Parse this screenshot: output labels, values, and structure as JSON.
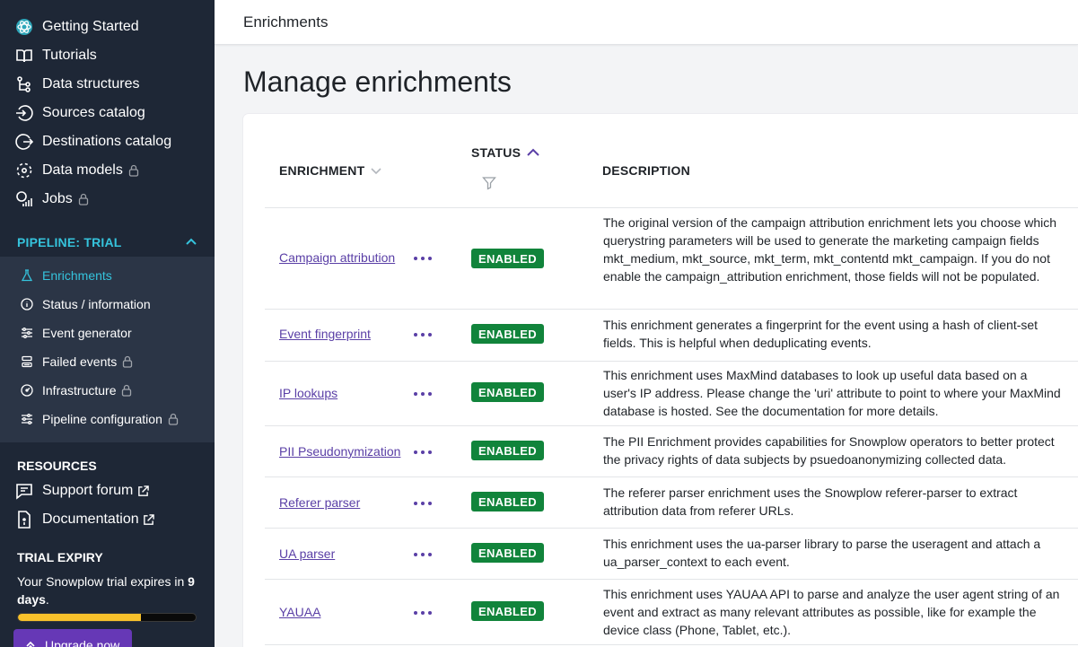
{
  "sidebar": {
    "nav": [
      {
        "label": "Getting Started",
        "icon": "atom-icon",
        "locked": false
      },
      {
        "label": "Tutorials",
        "icon": "book-icon",
        "locked": false
      },
      {
        "label": "Data structures",
        "icon": "hierarchy-icon",
        "locked": false
      },
      {
        "label": "Sources catalog",
        "icon": "source-enter-icon",
        "locked": false
      },
      {
        "label": "Destinations catalog",
        "icon": "destination-arrow-icon",
        "locked": false
      },
      {
        "label": "Data models",
        "icon": "model-dots-icon",
        "locked": true
      },
      {
        "label": "Jobs",
        "icon": "jobs-bars-icon",
        "locked": true
      }
    ],
    "pipeline": {
      "heading": "PIPELINE: TRIAL",
      "items": [
        {
          "label": "Enrichments",
          "icon": "flask-icon",
          "locked": false,
          "active": true
        },
        {
          "label": "Status / information",
          "icon": "info-circle-icon",
          "locked": false,
          "active": false
        },
        {
          "label": "Event generator",
          "icon": "sliders-icon",
          "locked": false,
          "active": false
        },
        {
          "label": "Failed events",
          "icon": "failed-layers-icon",
          "locked": true,
          "active": false
        },
        {
          "label": "Infrastructure",
          "icon": "gauge-icon",
          "locked": true,
          "active": false
        },
        {
          "label": "Pipeline configuration",
          "icon": "config-sliders-icon",
          "locked": true,
          "active": false
        }
      ]
    },
    "resources": {
      "heading": "RESOURCES",
      "items": [
        {
          "label": "Support forum",
          "icon": "chat-icon"
        },
        {
          "label": "Documentation",
          "icon": "document-icon"
        }
      ]
    },
    "trial": {
      "heading": "TRIAL EXPIRY",
      "text_prefix": "Your Snowplow trial expires in ",
      "days_number": "9",
      "text_days": "days",
      "text_suffix": ".",
      "progress_fraction": 0.69,
      "upgrade_label": "Upgrade now"
    }
  },
  "topbar": {
    "breadcrumb": "Enrichments"
  },
  "page": {
    "title": "Manage enrichments"
  },
  "table": {
    "columns": {
      "enrichment": "ENRICHMENT",
      "status": "STATUS",
      "description": "DESCRIPTION"
    },
    "rows": [
      {
        "name": "Campaign attribution",
        "status": "ENABLED",
        "description": "The original version of the campaign attribution enrichment lets you choose which querystring parameters will be used to generate the marketing campaign fields mkt_medium, mkt_source, mkt_term, mkt_contentd mkt_campaign. If you do not enable the campaign_attribution enrichment, those fields will not be populated."
      },
      {
        "name": "Event fingerprint",
        "status": "ENABLED",
        "description": "This enrichment generates a fingerprint for the event using a hash of client-set fields. This is helpful when deduplicating events."
      },
      {
        "name": "IP lookups",
        "status": "ENABLED",
        "description": "This enrichment uses MaxMind databases to look up useful data based on a user's IP address. Please change the 'uri' attribute to point to where your MaxMind database is hosted. See the documentation for more details."
      },
      {
        "name": "PII Pseudonymization",
        "status": "ENABLED",
        "description": "The PII Enrichment provides capabilities for Snowplow operators to better protect the privacy rights of data subjects by psuedoanonymizing collected data."
      },
      {
        "name": "Referer parser",
        "status": "ENABLED",
        "description": "The referer parser enrichment uses the Snowplow referer-parser to extract attribution data from referer URLs."
      },
      {
        "name": "UA parser",
        "status": "ENABLED",
        "description": "This enrichment uses the ua-parser library to parse the useragent and attach a ua_parser_context to each event."
      },
      {
        "name": "YAUAA",
        "status": "ENABLED",
        "description": "This enrichment uses YAUAA API to parse and analyze the user agent string of an event and extract as many relevant attributes as possible, like for example the device class (Phone, Tablet, etc.)."
      }
    ]
  },
  "colors": {
    "sidebar_bg": "#1e2736",
    "accent_cyan": "#35c3dc",
    "link_purple": "#5a3fa6",
    "enabled_green": "#11843b",
    "progress_yellow": "#f8c12b",
    "upgrade_purple": "#6638b6"
  }
}
